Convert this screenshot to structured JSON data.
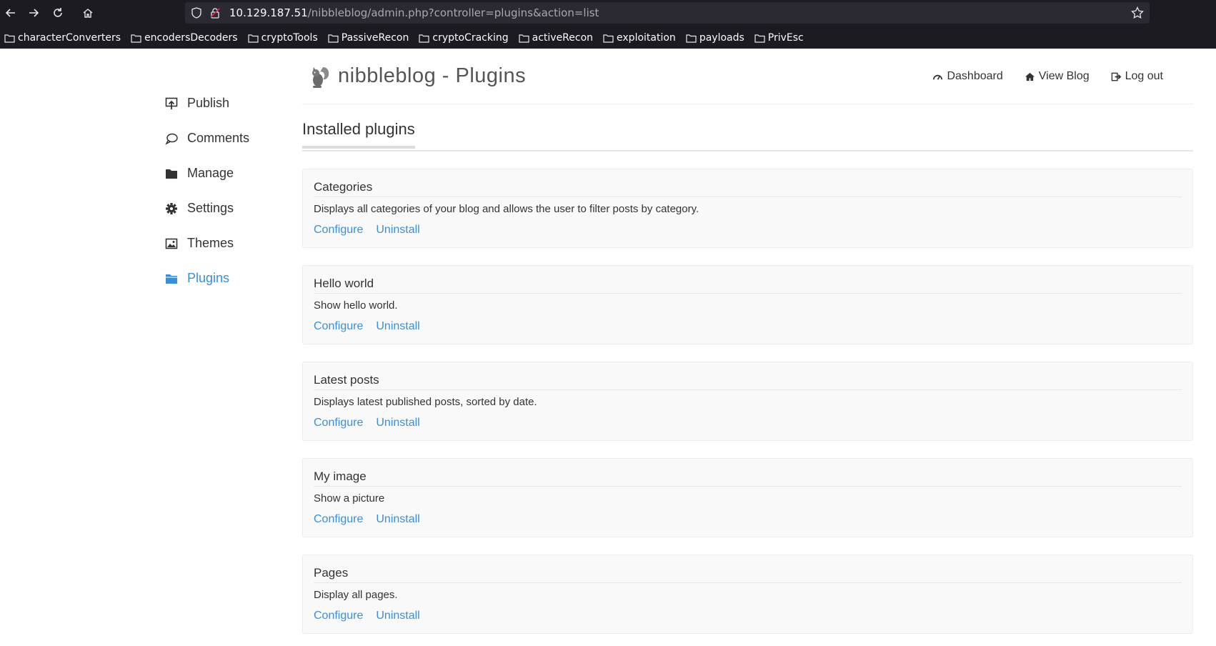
{
  "browser": {
    "url_host": "10.129.187.51",
    "url_path": "/nibbleblog/admin.php?controller=plugins&action=list",
    "bookmarks": [
      {
        "label": "characterConverters"
      },
      {
        "label": "encodersDecoders"
      },
      {
        "label": "cryptoTools"
      },
      {
        "label": "PassiveRecon"
      },
      {
        "label": "cryptoCracking"
      },
      {
        "label": "activeRecon"
      },
      {
        "label": "exploitation"
      },
      {
        "label": "payloads"
      },
      {
        "label": "PrivEsc"
      }
    ]
  },
  "header": {
    "brand": "nibbleblog - Plugins",
    "links": {
      "dashboard": "Dashboard",
      "view_blog": "View Blog",
      "logout": "Log out"
    }
  },
  "sidebar": {
    "items": [
      {
        "label": "Publish",
        "icon": "publish-icon"
      },
      {
        "label": "Comments",
        "icon": "comment-icon"
      },
      {
        "label": "Manage",
        "icon": "folder-icon"
      },
      {
        "label": "Settings",
        "icon": "gear-icon"
      },
      {
        "label": "Themes",
        "icon": "image-icon"
      },
      {
        "label": "Plugins",
        "icon": "folder-open-icon",
        "active": true
      }
    ],
    "active_color": "#3a8fd8"
  },
  "main": {
    "section_title": "Installed plugins",
    "plugins": [
      {
        "title": "Categories",
        "description": "Displays all categories of your blog and allows the user to filter posts by category.",
        "configure": "Configure",
        "uninstall": "Uninstall"
      },
      {
        "title": "Hello world",
        "description": "Show hello world.",
        "configure": "Configure",
        "uninstall": "Uninstall"
      },
      {
        "title": "Latest posts",
        "description": "Displays latest published posts, sorted by date.",
        "configure": "Configure",
        "uninstall": "Uninstall"
      },
      {
        "title": "My image",
        "description": "Show a picture",
        "configure": "Configure",
        "uninstall": "Uninstall"
      },
      {
        "title": "Pages",
        "description": "Display all pages.",
        "configure": "Configure",
        "uninstall": "Uninstall"
      }
    ]
  }
}
